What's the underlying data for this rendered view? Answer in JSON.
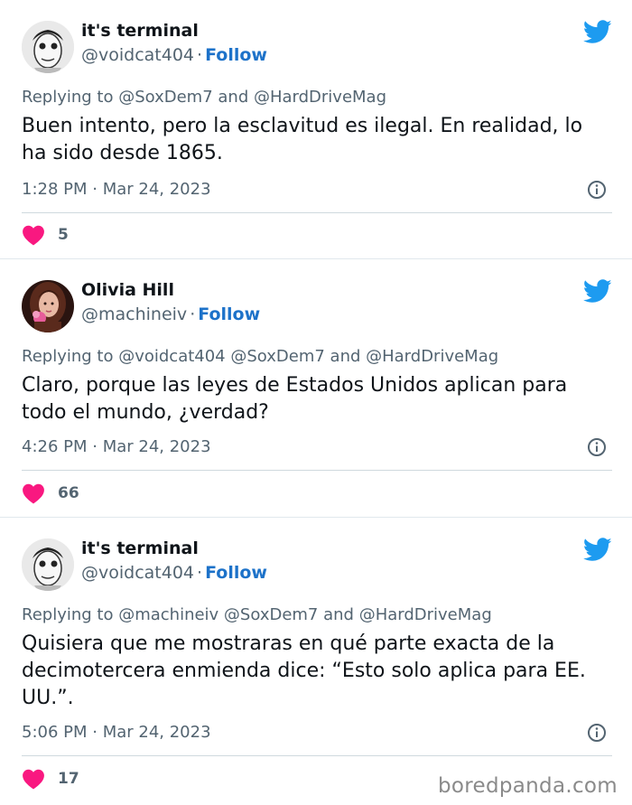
{
  "tweets": [
    {
      "name": "it's terminal",
      "handle": "@voidcat404",
      "separator": "·",
      "follow_label": "Follow",
      "replying": "Replying to @SoxDem7 and @HardDriveMag",
      "text": "Buen intento, pero la esclavitud es ilegal. En realidad, lo ha sido desde 1865.",
      "time": "1:28 PM · Mar 24, 2023",
      "likes": "5"
    },
    {
      "name": "Olivia Hill",
      "handle": "@machineiv",
      "separator": "·",
      "follow_label": "Follow",
      "replying": "Replying to @voidcat404 @SoxDem7 and @HardDriveMag",
      "text": "Claro, porque las leyes de Estados Unidos aplican para todo el mundo, ¿verdad?",
      "time": "4:26 PM · Mar 24, 2023",
      "likes": "66"
    },
    {
      "name": "it's terminal",
      "handle": "@voidcat404",
      "separator": "·",
      "follow_label": "Follow",
      "replying": "Replying to @machineiv @SoxDem7 and @HardDriveMag",
      "text": "Quisiera que me mostraras en qué parte exacta de la decimotercera enmienda dice: “Esto solo aplica para EE. UU.”.",
      "time": "5:06 PM · Mar 24, 2023",
      "likes": "17"
    }
  ],
  "watermark": "boredpanda.com",
  "icons": {
    "brand": "twitter-bird-icon",
    "info": "info-icon",
    "like": "heart-icon"
  },
  "colors": {
    "twitter_blue": "#1d9bf0",
    "follow_blue": "#1d72c9",
    "heart_pink": "#f91880",
    "secondary_text": "#536471"
  }
}
